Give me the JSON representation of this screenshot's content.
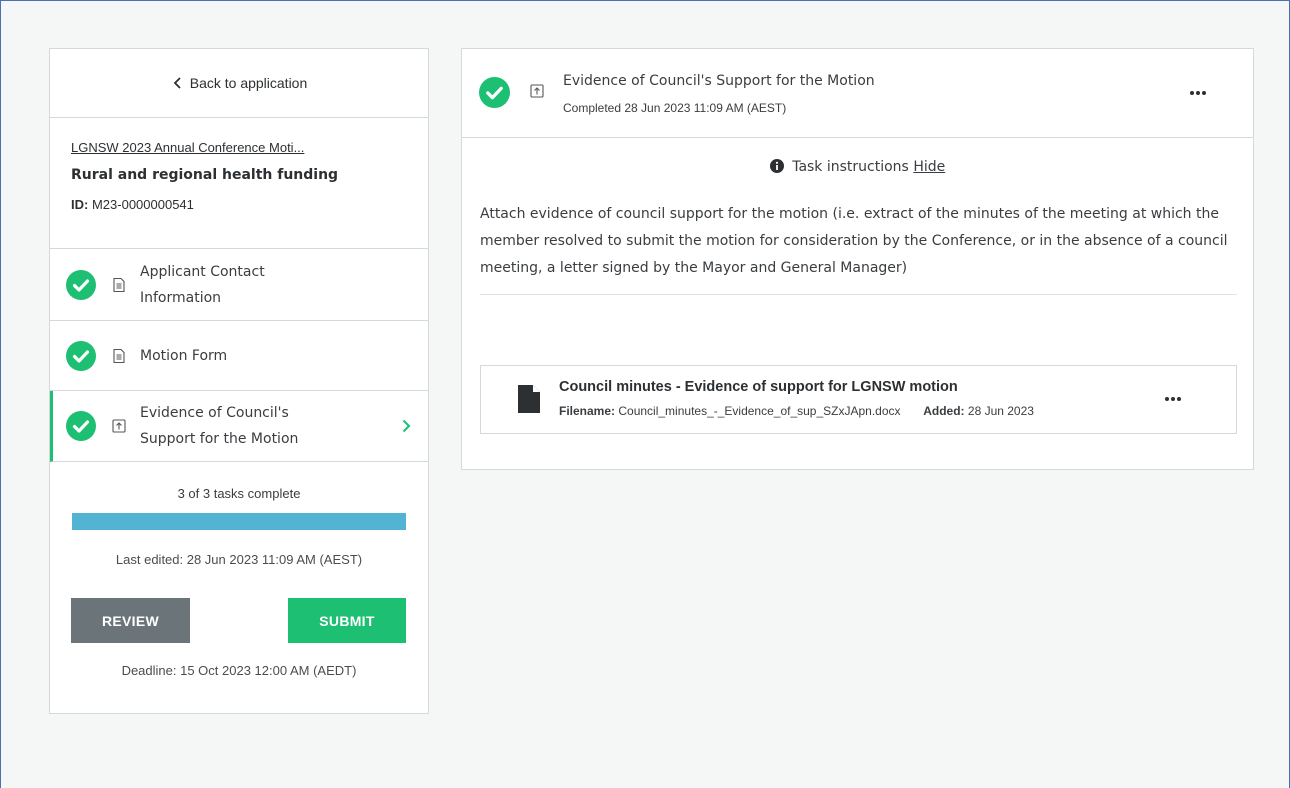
{
  "sidebar": {
    "back_label": "Back to application",
    "application": {
      "link_text": "LGNSW 2023 Annual Conference Moti...",
      "title": "Rural and regional health funding",
      "id_label": "ID:",
      "id_value": "M23-0000000541"
    },
    "tasks": [
      {
        "line1": "Applicant Contact",
        "line2": "Information",
        "status": "complete",
        "type": "form"
      },
      {
        "line1": "Motion Form",
        "line2": "",
        "status": "complete",
        "type": "form"
      },
      {
        "line1": "Evidence of Council's",
        "line2": "Support for the Motion",
        "status": "complete",
        "type": "upload",
        "active": true
      }
    ],
    "progress": {
      "text": "3 of 3 tasks complete",
      "fraction": 1.0
    },
    "last_edited": "Last edited: 28 Jun 2023 11:09 AM (AEST)",
    "buttons": {
      "review": "REVIEW",
      "submit": "SUBMIT"
    },
    "deadline": "Deadline: 15 Oct 2023 12:00 AM (AEDT)"
  },
  "main": {
    "task_title": "Evidence of Council's Support for the Motion",
    "task_status": "Completed 28 Jun 2023 11:09 AM (AEST)",
    "instructions_label": "Task instructions",
    "hide_label": "Hide",
    "instructions_text": "Attach evidence of council support for the motion (i.e. extract of the minutes of the meeting at which the member resolved to submit the motion for consideration by the Conference, or in the absence of a council meeting, a letter signed by the Mayor and General Manager)",
    "file": {
      "title": "Council minutes - Evidence of support for LGNSW motion",
      "filename_label": "Filename:",
      "filename": "Council_minutes_-_Evidence_of_sup_SZxJApn.docx",
      "added_label": "Added:",
      "added": "28 Jun 2023"
    }
  },
  "colors": {
    "accent_green": "#1dbf73",
    "progress_blue": "#53b3d2",
    "review_gray": "#6b7478",
    "border": "#d6d9dc"
  }
}
